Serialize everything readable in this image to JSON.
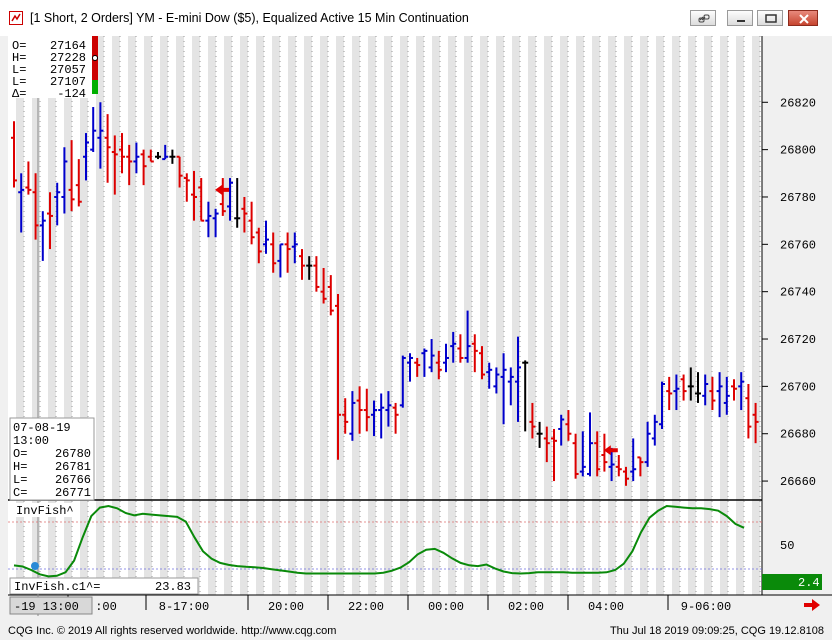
{
  "window": {
    "title": "[1 Short, 2 Orders]  YM - E-mini Dow ($5), Equalized Active 15 Min Continuation",
    "buttons": [
      "link-icon",
      "minimize-icon",
      "restore-icon",
      "close-icon"
    ]
  },
  "ohlc_box": {
    "rows": [
      {
        "label": "O=",
        "value": "27164"
      },
      {
        "label": "H=",
        "value": "27228"
      },
      {
        "label": "L=",
        "value": "27057"
      },
      {
        "label": "L=",
        "value": "27107"
      },
      {
        "label": "Δ=",
        "value": "-124"
      }
    ]
  },
  "cursor_box": {
    "date": "07-08-19",
    "time": "13:00",
    "rows": [
      {
        "label": "O=",
        "value": "26780"
      },
      {
        "label": "H=",
        "value": "26781"
      },
      {
        "label": "L=",
        "value": "26766"
      },
      {
        "label": "C=",
        "value": "26771"
      }
    ]
  },
  "indicator": {
    "name": "InvFish^",
    "value_label": "InvFish.c1^=",
    "value": "23.83",
    "axis_tick": "50",
    "current_badge": "2.4"
  },
  "time_axis": {
    "cursor_label": "-19  13:00",
    "labels": [
      ":00",
      "8-17:00",
      "20:00",
      "22:00",
      "00:00",
      "02:00",
      "04:00",
      "9-06:00"
    ]
  },
  "footer": {
    "copyright": "CQG Inc. © 2019 All rights reserved worldwide. http://www.cqg.com",
    "timestamp": "Thu Jul 18 2019 09:09:25, CQG 19.12.8108"
  },
  "colors": {
    "up": "#0000cc",
    "down": "#dd0000",
    "neutral": "#000000",
    "indicator": "#0a8a0a",
    "badge": "#0a8a0a"
  },
  "chart_data": {
    "type": "bar",
    "price_axis": {
      "ticks": [
        26820,
        26800,
        26780,
        26760,
        26740,
        26720,
        26700,
        26680,
        26660
      ],
      "range": [
        26652,
        26848
      ]
    },
    "ohlc_bars": [
      [
        26805,
        26812,
        26784,
        26787
      ],
      [
        26782,
        26790,
        26765,
        26783
      ],
      [
        26784,
        26795,
        26781,
        26783
      ],
      [
        26782,
        26790,
        26762,
        26768
      ],
      [
        26768,
        26774,
        26753,
        26770
      ],
      [
        26773,
        26782,
        26758,
        26772
      ],
      [
        26780,
        26786,
        26768,
        26782
      ],
      [
        26780,
        26801,
        26773,
        26795
      ],
      [
        26783,
        26804,
        26774,
        26779
      ],
      [
        26785,
        26796,
        26776,
        26778
      ],
      [
        26797,
        26807,
        26787,
        26803
      ],
      [
        26800,
        26818,
        26799,
        26808
      ],
      [
        26805,
        26820,
        26792,
        26808
      ],
      [
        26805,
        26815,
        26786,
        26801
      ],
      [
        26799,
        26806,
        26781,
        26798
      ],
      [
        26800,
        26807,
        26790,
        26797
      ],
      [
        26797,
        26802,
        26785,
        26795
      ],
      [
        26795,
        26803,
        26790,
        26797
      ],
      [
        26798,
        26800,
        26785,
        26793
      ],
      [
        26797,
        26800,
        26795,
        26795
      ],
      [
        26797,
        26799,
        26796,
        26797
      ],
      [
        26796,
        26802,
        26796,
        26797
      ],
      [
        26797,
        26800,
        26794,
        26797
      ],
      [
        26797,
        26797,
        26784,
        26789
      ],
      [
        26788,
        26790,
        26778,
        26787
      ],
      [
        26781,
        26791,
        26770,
        26780
      ],
      [
        26784,
        26788,
        26770,
        26770
      ],
      [
        26770,
        26778,
        26763,
        26772
      ],
      [
        26771,
        26775,
        26763,
        26773
      ],
      [
        26777,
        26788,
        26772,
        26774
      ],
      [
        26776,
        26788,
        26770,
        26786
      ],
      [
        26771,
        26788,
        26767,
        26771
      ],
      [
        26775,
        26780,
        26765,
        26773
      ],
      [
        26770,
        26778,
        26760,
        26763
      ],
      [
        26765,
        26767,
        26752,
        26757
      ],
      [
        26760,
        26770,
        26756,
        26762
      ],
      [
        26760,
        26765,
        26748,
        26752
      ],
      [
        26753,
        26760,
        26746,
        26760
      ],
      [
        26760,
        26765,
        26748,
        26758
      ],
      [
        26759,
        26765,
        26752,
        26760
      ],
      [
        26755,
        26758,
        26745,
        26751
      ],
      [
        26751,
        26755,
        26745,
        26751
      ],
      [
        26751,
        26755,
        26740,
        26742
      ],
      [
        26740,
        26750,
        26735,
        26737
      ],
      [
        26742,
        26747,
        26730,
        26732
      ],
      [
        26734,
        26739,
        26669,
        26688
      ],
      [
        26688,
        26695,
        26680,
        26685
      ],
      [
        26680,
        26698,
        26677,
        26693
      ],
      [
        26694,
        26700,
        26680,
        26690
      ],
      [
        26690,
        26699,
        26681,
        26687
      ],
      [
        26688,
        26694,
        26679,
        26690
      ],
      [
        26690,
        26697,
        26678,
        26691
      ],
      [
        26690,
        26698,
        26683,
        26692
      ],
      [
        26691,
        26693,
        26680,
        26688
      ],
      [
        26692,
        26713,
        26691,
        26712
      ],
      [
        26710,
        26714,
        26702,
        26712
      ],
      [
        26710,
        26712,
        26704,
        26709
      ],
      [
        26714,
        26716,
        26704,
        26715
      ],
      [
        26708,
        26720,
        26706,
        26713
      ],
      [
        26710,
        26715,
        26703,
        26707
      ],
      [
        26710,
        26718,
        26706,
        26712
      ],
      [
        26717,
        26723,
        26710,
        26718
      ],
      [
        26716,
        26722,
        26710,
        26712
      ],
      [
        26712,
        26732,
        26710,
        26717
      ],
      [
        26718,
        26722,
        26706,
        26715
      ],
      [
        26714,
        26717,
        26703,
        26705
      ],
      [
        26706,
        26710,
        26699,
        26707
      ],
      [
        26700,
        26708,
        26697,
        26705
      ],
      [
        26704,
        26714,
        26684,
        26707
      ],
      [
        26702,
        26708,
        26692,
        26704
      ],
      [
        26702,
        26721,
        26685,
        26708
      ],
      [
        26710,
        26711,
        26681,
        26710
      ],
      [
        26685,
        26693,
        26678,
        26683
      ],
      [
        26680,
        26685,
        26674,
        26680
      ],
      [
        26678,
        26683,
        26668,
        26676
      ],
      [
        26678,
        26682,
        26660,
        26677
      ],
      [
        26682,
        26688,
        26675,
        26686
      ],
      [
        26684,
        26690,
        26677,
        26680
      ],
      [
        26676,
        26680,
        26661,
        26663
      ],
      [
        26664,
        26681,
        26662,
        26666
      ],
      [
        26663,
        26689,
        26662,
        26676
      ],
      [
        26676,
        26681,
        26662,
        26665
      ],
      [
        26671,
        26680,
        26664,
        26668
      ],
      [
        26666,
        26674,
        26660,
        26667
      ],
      [
        26666,
        26671,
        26662,
        26665
      ],
      [
        26664,
        26666,
        26658,
        26661
      ],
      [
        26664,
        26678,
        26660,
        26665
      ],
      [
        26670,
        26670,
        26662,
        26668
      ],
      [
        26668,
        26685,
        26666,
        26680
      ],
      [
        26678,
        26688,
        26675,
        26685
      ],
      [
        26684,
        26702,
        26682,
        26701
      ],
      [
        26698,
        26704,
        26690,
        26697
      ],
      [
        26698,
        26705,
        26690,
        26699
      ],
      [
        26703,
        26705,
        26694,
        26698
      ],
      [
        26700,
        26708,
        26694,
        26700
      ],
      [
        26697,
        26706,
        26693,
        26697
      ],
      [
        26696,
        26705,
        26692,
        26701
      ],
      [
        26698,
        26704,
        26690,
        26694
      ],
      [
        26698,
        26706,
        26687,
        26700
      ],
      [
        26693,
        26704,
        26688,
        26696
      ],
      [
        26700,
        26703,
        26694,
        26699
      ],
      [
        26700,
        26706,
        26690,
        26702
      ],
      [
        26695,
        26701,
        26678,
        26683
      ],
      [
        26688,
        26693,
        26676,
        26685
      ]
    ],
    "indicator_series": [
      23.8,
      22.5,
      18.0,
      12.5,
      9.8,
      10.5,
      15.0,
      30.0,
      60.0,
      87.0,
      98.0,
      100.0,
      97.0,
      91.0,
      88.0,
      90.0,
      89.0,
      88.0,
      87.0,
      86.0,
      80.0,
      60.0,
      42.0,
      32.5,
      27.0,
      24.5,
      23.0,
      22.0,
      21.5,
      20.5,
      19.0,
      17.5,
      16.0,
      14.5,
      13.5,
      13.5,
      13.5,
      13.5,
      13.5,
      13.5,
      13.5,
      13.5,
      13.5,
      14.5,
      17.0,
      21.0,
      28.0,
      38.0,
      44.0,
      45.0,
      40.0,
      33.0,
      27.0,
      24.0,
      23.0,
      25.0,
      20.0,
      16.0,
      14.0,
      13.5,
      14.0,
      15.0,
      15.0,
      15.0,
      15.0,
      14.5,
      14.5,
      14.5,
      14.5,
      15.0,
      18.0,
      26.0,
      42.0,
      66.0,
      85.0,
      94.0,
      100.0,
      99.0,
      98.0,
      97.0,
      97.0,
      96.0,
      94.0,
      87.0,
      77.0,
      72.0
    ],
    "trade_markers": [
      {
        "price": 26783,
        "direction": "left"
      },
      {
        "price": 26673,
        "direction": "left"
      }
    ],
    "indicator_range": [
      0,
      100
    ]
  }
}
